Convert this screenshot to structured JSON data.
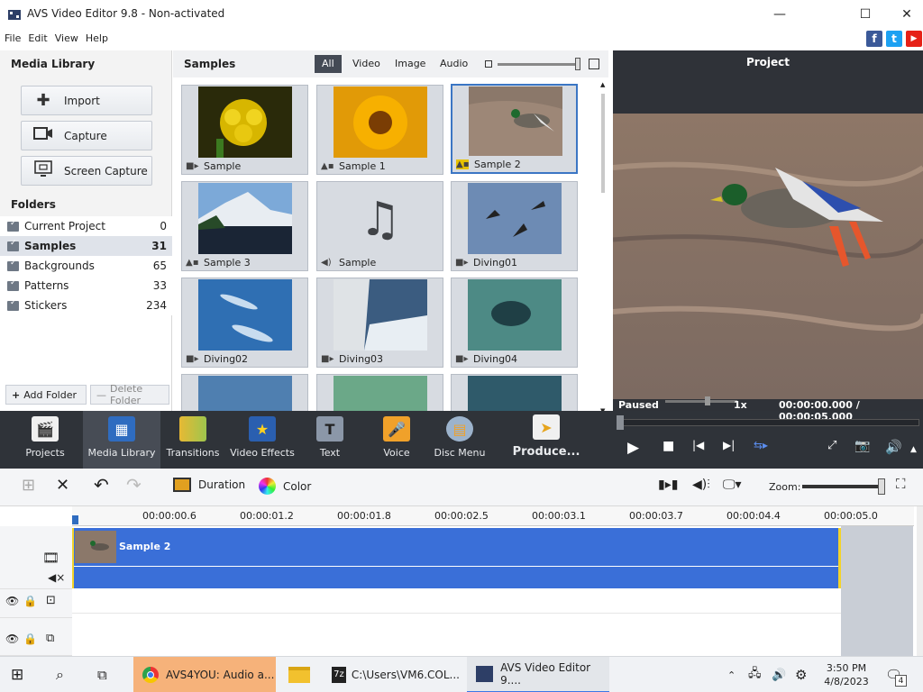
{
  "window": {
    "title": "AVS Video Editor 9.8 - Non-activated",
    "min": "—",
    "max": "☐",
    "close": "✕"
  },
  "menu": [
    "File",
    "Edit",
    "View",
    "Help"
  ],
  "social": {
    "facebook": "f",
    "twitter": "t",
    "youtube": "▶"
  },
  "media_library": {
    "heading": "Media Library",
    "buttons": [
      {
        "label": "Import",
        "icon": "plus-icon"
      },
      {
        "label": "Capture",
        "icon": "camera-icon"
      },
      {
        "label": "Screen Capture",
        "icon": "screen-capture-icon"
      }
    ],
    "folders_heading": "Folders",
    "folders": [
      {
        "name": "Current Project",
        "count": "0"
      },
      {
        "name": "Samples",
        "count": "31"
      },
      {
        "name": "Backgrounds",
        "count": "65"
      },
      {
        "name": "Patterns",
        "count": "33"
      },
      {
        "name": "Stickers",
        "count": "234"
      }
    ],
    "add_folder": "Add Folder",
    "delete_folder": "Delete Folder"
  },
  "samples": {
    "heading": "Samples",
    "filters": [
      "All",
      "Video",
      "Image",
      "Audio"
    ],
    "tiles": [
      {
        "label": "Sample",
        "kind": "video"
      },
      {
        "label": "Sample 1",
        "kind": "image"
      },
      {
        "label": "Sample 2",
        "kind": "image"
      },
      {
        "label": "Sample 3",
        "kind": "image"
      },
      {
        "label": "Sample",
        "kind": "audio"
      },
      {
        "label": "Diving01",
        "kind": "video"
      },
      {
        "label": "Diving02",
        "kind": "video"
      },
      {
        "label": "Diving03",
        "kind": "video"
      },
      {
        "label": "Diving04",
        "kind": "video"
      }
    ]
  },
  "preview": {
    "title": "Project",
    "status": "Paused",
    "speed": "1x",
    "time": "00:00:00.000 / 00:00:05.000"
  },
  "modes": [
    "Projects",
    "Media Library",
    "Transitions",
    "Video Effects",
    "Text",
    "Voice",
    "Disc Menu",
    "Produce..."
  ],
  "timeline_toolbar": {
    "duration": "Duration",
    "color": "Color",
    "zoom": "Zoom:"
  },
  "timeline": {
    "ticks": [
      "00:00:00.6",
      "00:00:01.2",
      "00:00:01.8",
      "00:00:02.5",
      "00:00:03.1",
      "00:00:03.7",
      "00:00:04.4",
      "00:00:05.0"
    ],
    "clip_label": "Sample 2"
  },
  "taskbar": {
    "apps": [
      {
        "label": "AVS4YOU: Audio a...",
        "icon": "chrome-icon"
      },
      {
        "label": "",
        "icon": "folder-icon"
      },
      {
        "label": "C:\\Users\\VM6.COL...",
        "icon": "7zip-icon"
      },
      {
        "label": "AVS Video Editor 9....",
        "icon": "avs-icon"
      }
    ],
    "time": "3:50 PM",
    "date": "4/8/2023",
    "notifications": "4"
  }
}
